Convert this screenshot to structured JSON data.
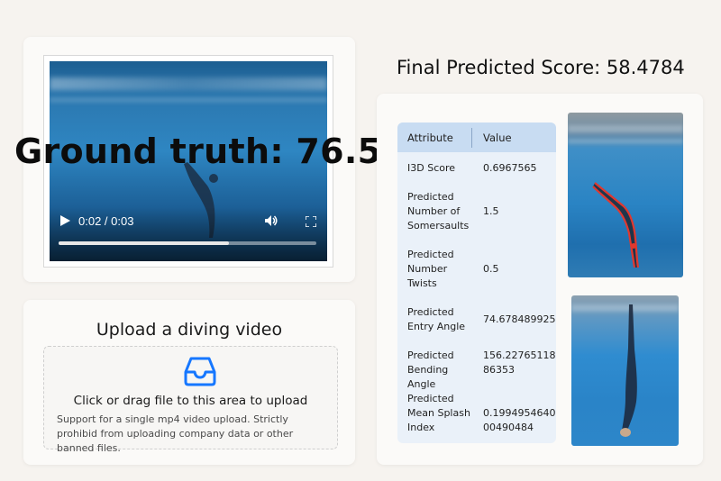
{
  "video": {
    "time": "0:02 / 0:03",
    "progress_fraction": 0.66,
    "play_icon": "play-icon",
    "volume_icon": "volume-icon",
    "fullscreen_icon": "fullscreen-icon"
  },
  "overlay": {
    "ground_truth": "Ground truth: 76.5"
  },
  "upload": {
    "title": "Upload a diving video",
    "icon": "inbox-icon",
    "main_text": "Click or drag file to this area to upload",
    "hint": "Support for a single mp4 video upload. Strictly prohibid from uploading company data or other banned files."
  },
  "results": {
    "final_score": "Final Predicted Score: 58.4784",
    "table": {
      "headers": [
        "Attribute",
        "Value"
      ],
      "rows": [
        {
          "attribute": "I3D Score",
          "value": "0.6967565"
        },
        {
          "attribute": "Predicted Number of Somersaults",
          "value": "1.5"
        },
        {
          "attribute": "Predicted Number Twists",
          "value": "0.5"
        },
        {
          "attribute": "Predicted Entry Angle",
          "value": "74.678489925"
        },
        {
          "attribute": "Predicted Bending Angle",
          "value": "156.2276511886353"
        },
        {
          "attribute": "Predicted Mean Splash Index",
          "value": "0.199495464000490484"
        }
      ]
    }
  },
  "colors": {
    "accent_blue": "#1677ff",
    "table_header_bg": "#c8dcf2",
    "table_bg": "#eaf1f9",
    "pose_overlay": "#e0382f"
  }
}
